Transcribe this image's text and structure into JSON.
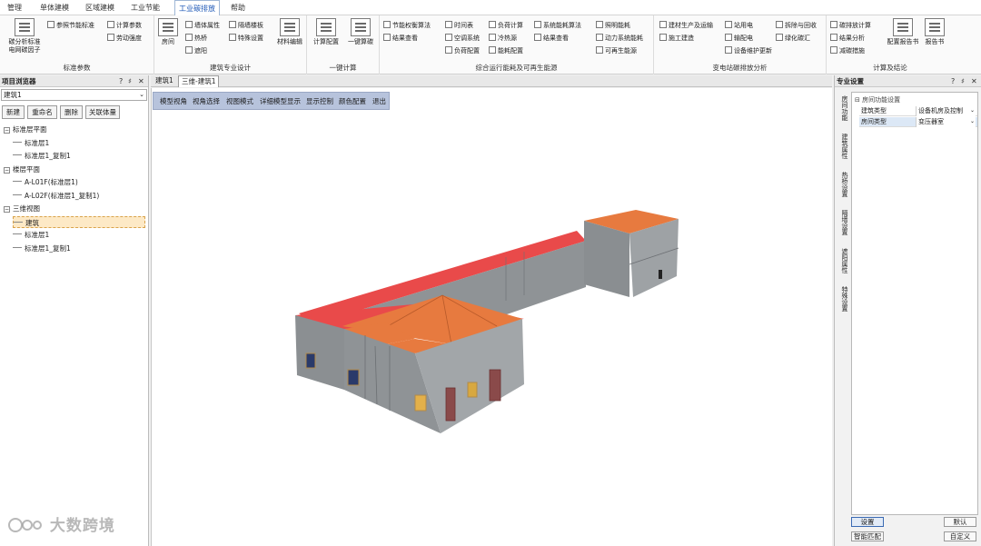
{
  "menu_tabs": [
    "管理",
    "单体建模",
    "区域建模",
    "工业节能",
    "工业碳排放",
    "帮助"
  ],
  "ribbon": {
    "group_std": {
      "label": "标准参数",
      "big": "碳分析标准\n电网碳因子",
      "small": [
        "参照节能标准",
        "计算参数",
        "劳动强度"
      ]
    },
    "group_design": {
      "label": "建筑专业设计",
      "big": "房间",
      "small": [
        "墙体属性",
        "隔墙楼板",
        "热桥",
        "特殊设置",
        "遮阳"
      ],
      "big2": "材料编辑"
    },
    "group_onekey": {
      "label": "一键计算",
      "big": [
        "计算配置",
        "一键算碳"
      ]
    },
    "group_ops": {
      "label": "综合运行能耗及可再生能源",
      "small": [
        "节能权衡算法",
        "结果查看",
        "时间表",
        "空调系统",
        "负荷配置",
        "负荷计算",
        "冷热源",
        "能耗配置",
        "系统能耗算法",
        "结果查看",
        "照明能耗",
        "动力系统能耗",
        "可再生能源"
      ]
    },
    "group_substation": {
      "label": "变电站碳排放分析",
      "small": [
        "建材生产及运输",
        "施工建造",
        "站用电",
        "输配电",
        "设备维护更新",
        "拆除与回收",
        "绿化碳汇"
      ]
    },
    "group_result": {
      "label": "计算及结论",
      "small": [
        "碳排放计算",
        "结果分析",
        "减碳措施"
      ],
      "big": [
        "配置报告书",
        "报告书"
      ]
    }
  },
  "left_panel": {
    "title": "项目浏览器",
    "controls": [
      "?",
      "♯",
      "✕"
    ],
    "building_select": "建筑1",
    "buttons": [
      "新建",
      "重命名",
      "删除",
      "关联体量"
    ],
    "tree": [
      {
        "label": "标准层平面",
        "level": 0,
        "expander": "−"
      },
      {
        "label": "标准层1",
        "level": 1
      },
      {
        "label": "标准层1_复制1",
        "level": 1
      },
      {
        "label": "楼层平面",
        "level": 0,
        "expander": "−"
      },
      {
        "label": "A-L01F(标准层1)",
        "level": 1
      },
      {
        "label": "A-L02F(标准层1_复制1)",
        "level": 1
      },
      {
        "label": "三维视图",
        "level": 0,
        "expander": "−"
      },
      {
        "label": "建筑",
        "level": 1,
        "selected": true
      },
      {
        "label": "标准层1",
        "level": 1
      },
      {
        "label": "标准层1_复制1",
        "level": 1
      }
    ]
  },
  "view": {
    "tabs": [
      "建筑1",
      "三维-建筑1"
    ],
    "toolbar": [
      "模型视角",
      "视角选择",
      "视图模式",
      "详细模型显示",
      "显示控制",
      "颜色配置",
      "退出"
    ]
  },
  "right_panel": {
    "title": "专业设置",
    "controls": [
      "?",
      "♯",
      "✕"
    ],
    "side_tabs": [
      "房间功能",
      "建筑属性",
      "热桥设置",
      "隔墙设置",
      "遮阳属性",
      "特殊设置"
    ],
    "section": "房间功能设置",
    "rows": [
      {
        "key": "建筑类型",
        "value": "设备机房及控制"
      },
      {
        "key": "房间类型",
        "value": "变压器室"
      }
    ],
    "buttons": {
      "set": "设置",
      "default": "默认",
      "smart": "智能匹配",
      "custom": "自定义"
    }
  },
  "watermark": "大数跨境",
  "colors": {
    "roof_orange": "#e77a3f",
    "roof_red": "#e94a4a",
    "wall_gray": "#8f9396",
    "accent_blue": "#1a55b5"
  }
}
